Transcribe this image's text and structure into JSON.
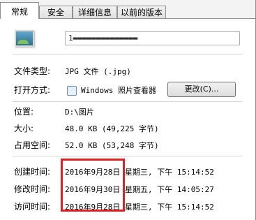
{
  "tabs": [
    "常规",
    "安全",
    "详细信息",
    "以前的版本"
  ],
  "file": {
    "name": "1▬▬▬▬▬▬▬▬▬▬▬▬▬▬"
  },
  "labels": {
    "type": "文件类型:",
    "opens_with": "打开方式:",
    "location": "位置:",
    "size": "大小:",
    "size_on_disk": "占用空间:",
    "created": "创建时间:",
    "modified": "修改时间:",
    "accessed": "访问时间:"
  },
  "values": {
    "type": "JPG 文件 (.jpg)",
    "opens_with": "Windows 照片查看器",
    "location": "D:\\图片",
    "size": "48.0 KB (49,225 字节)",
    "size_on_disk": "52.0 KB (53,248 字节)",
    "created": "2016年9月28日 星期三, 下午 15:14:52",
    "modified": "2016年9月30日 星期五, 下午 14:05:27",
    "accessed": "2016年9月28日 星期三, 下午 15:14:52"
  },
  "buttons": {
    "change": "更改(C)..."
  },
  "annotation_color": "#e02020"
}
